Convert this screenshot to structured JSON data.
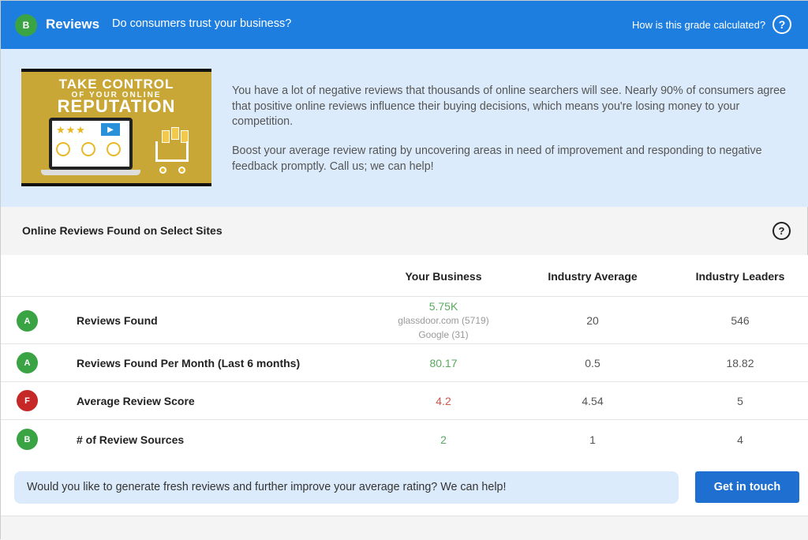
{
  "header": {
    "grade": "B",
    "title": "Reviews",
    "subtitle": "Do consumers trust your business?",
    "grade_link": "How is this grade calculated?",
    "help_glyph": "?"
  },
  "promo": {
    "line1": "TAKE CONTROL",
    "line2": "OF YOUR ONLINE",
    "line3": "REPUTATION",
    "stars": "★★★",
    "play_glyph": "▶"
  },
  "info": {
    "paragraph1": "You have a lot of negative reviews that thousands of online searchers will see. Nearly 90% of consumers agree that positive online reviews influence their buying decisions, which means you're losing money to your competition.",
    "paragraph2": "Boost your average review rating by uncovering areas in need of improvement and responding to negative feedback promptly. Call us; we can help!"
  },
  "section": {
    "title": "Online Reviews Found on Select Sites",
    "help_glyph": "?"
  },
  "table": {
    "columns": [
      "Your Business",
      "Industry Average",
      "Industry Leaders"
    ],
    "rows": [
      {
        "grade": "A",
        "label": "Reviews Found",
        "your_business": "5.75K",
        "sources": [
          "glassdoor.com (5719)",
          "Google (31)"
        ],
        "industry_average": "20",
        "industry_leaders": "546"
      },
      {
        "grade": "A",
        "label": "Reviews Found Per Month (Last 6 months)",
        "your_business": "80.17",
        "industry_average": "0.5",
        "industry_leaders": "18.82"
      },
      {
        "grade": "F",
        "label": "Average Review Score",
        "your_business": "4.2",
        "industry_average": "4.54",
        "industry_leaders": "5"
      },
      {
        "grade": "B",
        "label": "# of Review Sources",
        "your_business": "2",
        "industry_average": "1",
        "industry_leaders": "4"
      }
    ]
  },
  "cta": {
    "text": "Would you like to generate fresh reviews and further improve your average rating? We can help!",
    "button": "Get in touch"
  },
  "colors": {
    "header_blue": "#1e7ee0",
    "grade_green": "#3aa445",
    "grade_red": "#c62828",
    "value_good": "#5aa85f",
    "value_bad": "#c9574a",
    "button_blue": "#1e6fd0"
  }
}
